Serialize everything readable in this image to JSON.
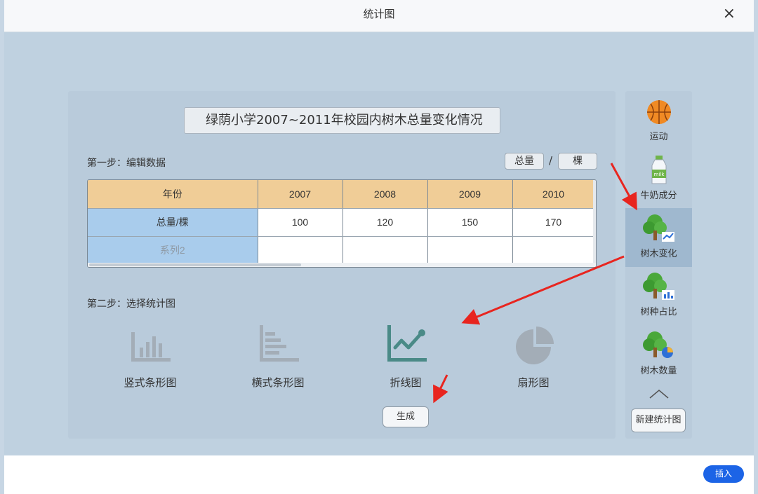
{
  "window": {
    "title": "统计图",
    "close_label": "×"
  },
  "chart_title_value": "绿荫小学2007~2011年校园内树木总量变化情况",
  "step1": {
    "label": "第一步：编辑数据",
    "unit_quantity": "总量",
    "unit_separator": "/",
    "unit_name": "棵"
  },
  "table": {
    "header": [
      "年份",
      "2007",
      "2008",
      "2009",
      "2010"
    ],
    "rows": [
      [
        "总量/棵",
        "100",
        "120",
        "150",
        "170"
      ],
      [
        "系列2",
        "",
        "",
        "",
        ""
      ]
    ]
  },
  "step2": {
    "label": "第二步：选择统计图",
    "options": [
      {
        "label": "竖式条形图",
        "icon": "vertical-bar-chart-icon",
        "selected": false
      },
      {
        "label": "横式条形图",
        "icon": "horizontal-bar-chart-icon",
        "selected": false
      },
      {
        "label": "折线图",
        "icon": "line-chart-icon",
        "selected": true
      },
      {
        "label": "扇形图",
        "icon": "pie-chart-icon",
        "selected": false
      }
    ],
    "generate_label": "生成"
  },
  "sidebar": {
    "items": [
      {
        "label": "运动",
        "icon": "basketball-icon"
      },
      {
        "label": "牛奶成分",
        "icon": "milk-bottle-icon"
      },
      {
        "label": "树木变化",
        "icon": "tree-line-chart-icon",
        "active": true
      },
      {
        "label": "树种占比",
        "icon": "tree-bar-chart-icon"
      },
      {
        "label": "树木数量",
        "icon": "tree-pie-chart-icon"
      }
    ],
    "new_chart_label": "新建统计图"
  },
  "footer": {
    "insert_label": "插入"
  },
  "colors": {
    "accent": "#1c64e6",
    "table_header": "#f0cd97",
    "row_header": "#a9ccec",
    "selected_icon": "#4a8a87",
    "unselected_icon": "#a3adb7"
  }
}
